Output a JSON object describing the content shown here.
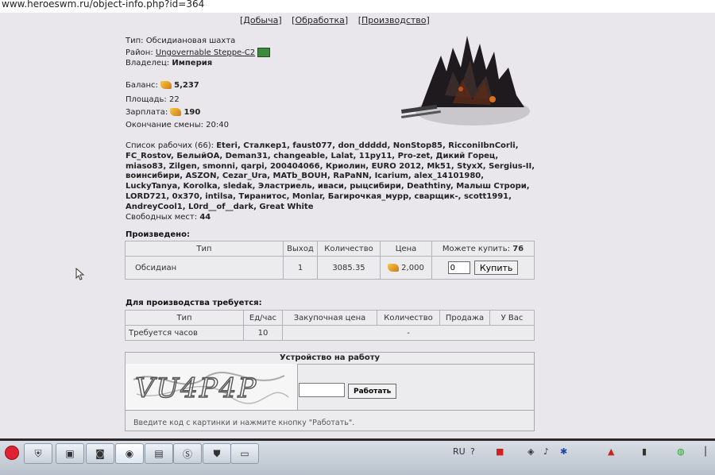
{
  "browser": {
    "url": "www.heroeswm.ru/object-info.php?id=364"
  },
  "tabs": [
    {
      "label": "Добыча",
      "active": true
    },
    {
      "label": "Обработка",
      "active": false
    },
    {
      "label": "Производство",
      "active": false
    }
  ],
  "object": {
    "type_label": "Тип:",
    "type_value": "Обсидиановая шахта",
    "district_label": "Район:",
    "district_value": "Ungovernable Steppe-C2",
    "owner_label": "Владелец:",
    "owner_value": "Империя",
    "balance_label": "Баланс:",
    "balance_value": "5,237",
    "area_label": "Площадь:",
    "area_value": "22",
    "salary_label": "Зарплата:",
    "salary_value": "190",
    "shift_end_label": "Окончание смены:",
    "shift_end_value": "20:40"
  },
  "workers": {
    "label": "Список рабочих (66):",
    "names": "Eteri, Сталкер1, faust077, don_ddddd, NonStop85, RicconiIbnCorli, FC_Rostov, БелыйОА, Deman31, changeable, Lalat, 11py11, Pro-zet, Дикий Горец, miaso83, Zilgen, smonni, qarpi, 200404066, Криолин, EURO 2012, Mk51, StyxX, Sergius-II, воинсибири, ASZON, Cezar_Ura, MATb_BOUH, RaPaNN, Icarium, alex_14101980, LuckyTanya, Korolka, sledak, Эластриель, иваси, рыцсибири, Deathtiny, Малыш Строри, LORD721, 0x370, intilsa, Тиранитос, Monlar, Багирочкая_мурр, сварщик-, scott1991, AndreyCool1, L0rd__of__dark, Great White",
    "free_label": "Свободных мест:",
    "free_value": "44"
  },
  "produced": {
    "title": "Произведено:",
    "headers": [
      "Тип",
      "Выход",
      "Количество",
      "Цена"
    ],
    "can_buy_label": "Можете купить:",
    "can_buy_value": "76",
    "row": {
      "type": "Обсидиан",
      "output": "1",
      "quantity": "3085.35",
      "price": "2,000"
    },
    "buy_input_value": "0",
    "buy_button": "Купить"
  },
  "requirements": {
    "title": "Для производства требуется:",
    "headers": [
      "Тип",
      "Ед/час",
      "Закупочная цена",
      "Количество",
      "Продажа",
      "У Вас"
    ],
    "row": {
      "type": "Требуется часов",
      "per_hour": "10",
      "dash": "-"
    }
  },
  "device": {
    "title": "Устройство на работу",
    "captcha_text": "VU4P4P",
    "work_button": "Работать",
    "note": "Введите код с картинки и нажмите кнопку \"Работать\"."
  },
  "taskbar": {
    "lang": "RU"
  }
}
